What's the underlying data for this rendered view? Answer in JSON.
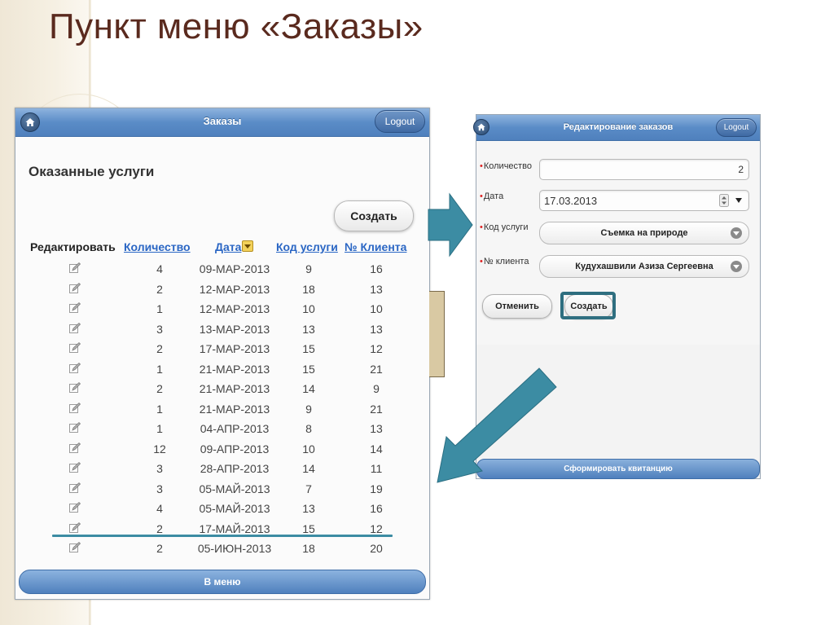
{
  "slide_title": "Пункт меню «Заказы»",
  "orders": {
    "header_title": "Заказы",
    "logout_label": "Logout",
    "section_title": "Оказанные услуги",
    "create_label": "Создать",
    "columns": {
      "edit": "Редактировать",
      "quantity": "Количество",
      "date": "Дата",
      "service_code": "Код услуги",
      "client_no": "№ Клиента"
    },
    "rows": [
      {
        "q": "4",
        "d": "09-МАР-2013",
        "c": "9",
        "n": "16"
      },
      {
        "q": "2",
        "d": "12-МАР-2013",
        "c": "18",
        "n": "13"
      },
      {
        "q": "1",
        "d": "12-МАР-2013",
        "c": "10",
        "n": "10"
      },
      {
        "q": "3",
        "d": "13-МАР-2013",
        "c": "13",
        "n": "13"
      },
      {
        "q": "2",
        "d": "17-МАР-2013",
        "c": "15",
        "n": "12"
      },
      {
        "q": "1",
        "d": "21-МАР-2013",
        "c": "15",
        "n": "21"
      },
      {
        "q": "2",
        "d": "21-МАР-2013",
        "c": "14",
        "n": "9"
      },
      {
        "q": "1",
        "d": "21-МАР-2013",
        "c": "9",
        "n": "21"
      },
      {
        "q": "1",
        "d": "04-АПР-2013",
        "c": "8",
        "n": "13"
      },
      {
        "q": "12",
        "d": "09-АПР-2013",
        "c": "10",
        "n": "14"
      },
      {
        "q": "3",
        "d": "28-АПР-2013",
        "c": "14",
        "n": "11"
      },
      {
        "q": "3",
        "d": "05-МАЙ-2013",
        "c": "7",
        "n": "19"
      },
      {
        "q": "4",
        "d": "05-МАЙ-2013",
        "c": "13",
        "n": "16"
      },
      {
        "q": "2",
        "d": "17-МАЙ-2013",
        "c": "15",
        "n": "12"
      },
      {
        "q": "2",
        "d": "05-ИЮН-2013",
        "c": "18",
        "n": "20"
      }
    ],
    "menu_label": "В меню"
  },
  "edit": {
    "header_title": "Редактирование заказов",
    "logout_label": "Logout",
    "quantity_label": "Количество",
    "quantity_value": "2",
    "date_label": "Дата",
    "date_value": "17.03.2013",
    "service_label": "Код услуги",
    "service_value": "Съемка на природе",
    "client_label": "№ клиента",
    "client_value": "Кудухашвили Азиза Сергеевна",
    "cancel_label": "Отменить",
    "create_label": "Создать",
    "receipt_label": "Сформировать квитанцию"
  },
  "colors": {
    "title": "#5a2a1e",
    "bar_blue": "#4f80bd",
    "link_blue": "#2a66c4",
    "arrow_teal": "#3c8ca3"
  },
  "icons": [
    "home-icon",
    "edit-pencil-icon",
    "sort-icon",
    "chevron-down-icon",
    "spinner-icon",
    "arrow-right-icon",
    "arrow-down-left-icon"
  ]
}
